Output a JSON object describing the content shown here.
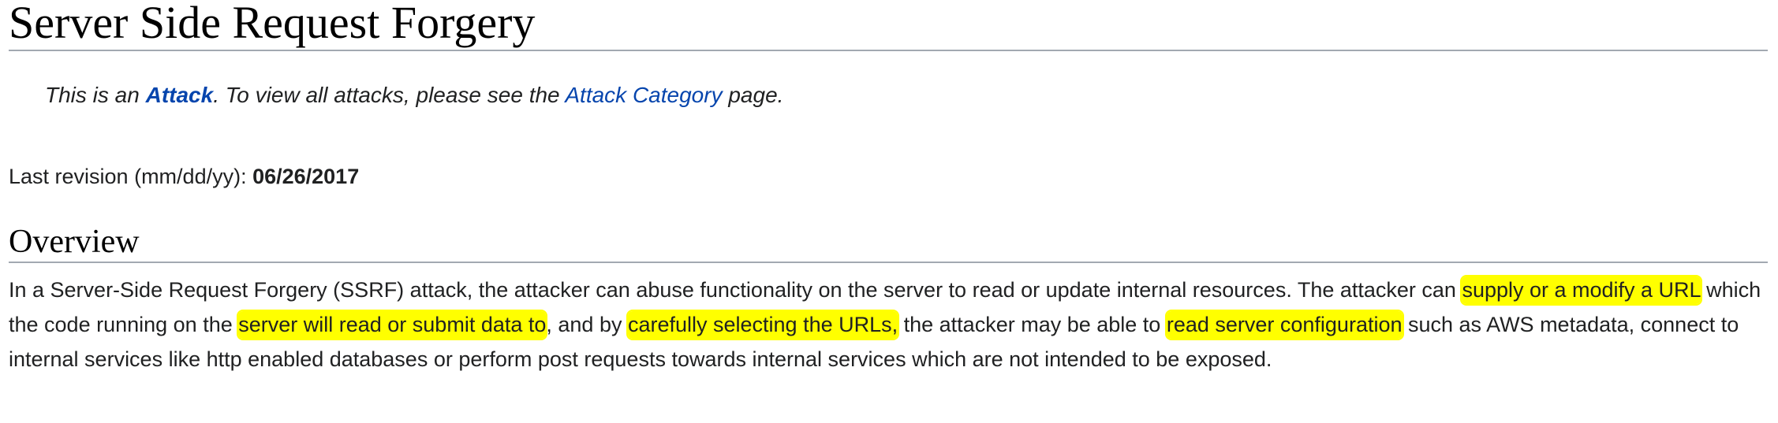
{
  "page": {
    "title": "Server Side Request Forgery"
  },
  "hatnote": {
    "prefix": "This is an ",
    "attack_link": "Attack",
    "middle": ". To view all attacks, please see the ",
    "category_link": "Attack Category",
    "suffix": " page."
  },
  "revision": {
    "label": "Last revision (mm/dd/yy): ",
    "date": "06/26/2017"
  },
  "overview": {
    "heading": "Overview",
    "segments": [
      {
        "text": "In a Server-Side Request Forgery (SSRF) attack, the attacker can abuse functionality on the server to read or update internal resources. The attacker can ",
        "highlight": false
      },
      {
        "text": "supply or a modify a URL",
        "highlight": true
      },
      {
        "text": " which the code running on the ",
        "highlight": false
      },
      {
        "text": "server will read or submit data to",
        "highlight": true
      },
      {
        "text": ", and by ",
        "highlight": false
      },
      {
        "text": "carefully selecting the URLs,",
        "highlight": true
      },
      {
        "text": " the attacker may be able to ",
        "highlight": false
      },
      {
        "text": "read server configuration",
        "highlight": true
      },
      {
        "text": " such as AWS metadata, connect to internal services like http enabled databases or perform post requests towards internal services which are not intended to be exposed.",
        "highlight": false
      }
    ]
  },
  "colors": {
    "highlight": "#ffff00",
    "link": "#0645ad",
    "text": "#202122",
    "rule": "#a2a9b1"
  }
}
